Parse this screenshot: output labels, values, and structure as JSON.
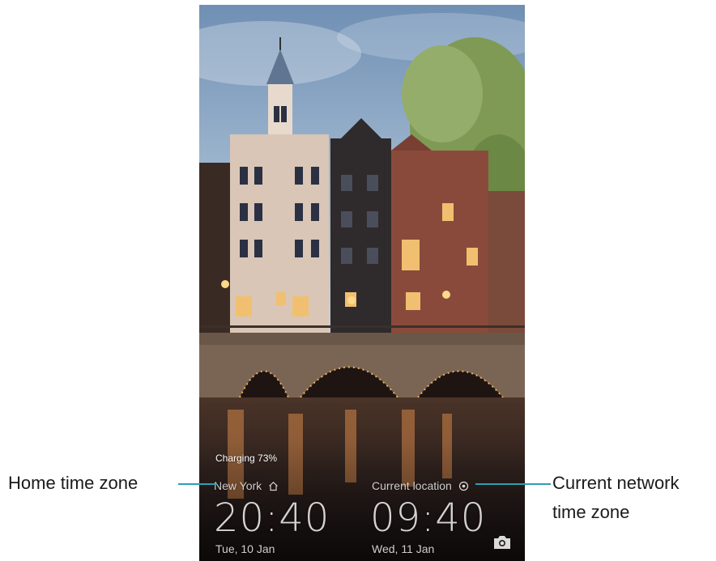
{
  "lockscreen": {
    "charging_text": "Charging 73%",
    "home": {
      "city": "New York",
      "time": "20:40",
      "date": "Tue, 10 Jan"
    },
    "current": {
      "city": "Current location",
      "time": "09:40",
      "date": "Wed, 11 Jan"
    },
    "icons": {
      "home": "home-icon",
      "location": "location-icon",
      "camera": "camera-icon"
    }
  },
  "callouts": {
    "home_timezone": "Home time zone",
    "network_timezone_line1": "Current network",
    "network_timezone_line2": "time zone"
  },
  "colors": {
    "leader_line": "#2e9fb3",
    "text": "#1a1a1a"
  }
}
